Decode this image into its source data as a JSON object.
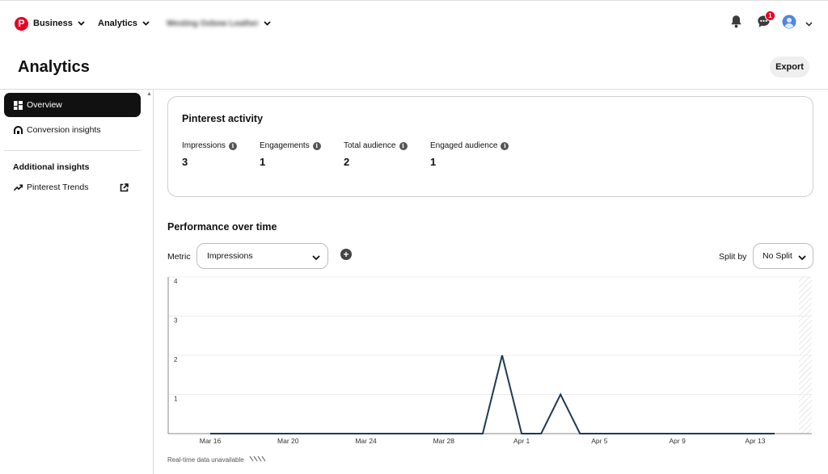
{
  "topnav": {
    "business_label": "Business",
    "analytics_label": "Analytics",
    "account_name": "Westing Oxbow Leather",
    "notification_count": "1"
  },
  "header": {
    "title": "Analytics",
    "export_label": "Export"
  },
  "sidebar": {
    "items": [
      {
        "label": "Overview",
        "active": true,
        "icon": "dashboard-icon"
      },
      {
        "label": "Conversion insights",
        "icon": "conversion-icon"
      }
    ],
    "additional_heading": "Additional insights",
    "extra_items": [
      {
        "label": "Pinterest Trends",
        "icon": "trend-icon"
      }
    ]
  },
  "activity": {
    "title": "Pinterest activity",
    "metrics": [
      {
        "label": "Impressions",
        "value": "3"
      },
      {
        "label": "Engagements",
        "value": "1"
      },
      {
        "label": "Total audience",
        "value": "2"
      },
      {
        "label": "Engaged audience",
        "value": "1"
      }
    ]
  },
  "performance": {
    "title": "Performance over time",
    "metric_label": "Metric",
    "metric_value": "Impressions",
    "split_label": "Split by",
    "split_value": "No Split",
    "realtime_note": "Real-time data unavailable"
  },
  "chart_data": {
    "type": "line",
    "title": "",
    "xlabel": "",
    "ylabel": "",
    "ylim": [
      0,
      4
    ],
    "yticks": [
      1,
      2,
      3,
      4
    ],
    "x_tick_labels": [
      "Mar 16",
      "Mar 20",
      "Mar 24",
      "Mar 28",
      "Apr 1",
      "Apr 5",
      "Apr 9",
      "Apr 13"
    ],
    "x": [
      "Mar 16",
      "Mar 17",
      "Mar 18",
      "Mar 19",
      "Mar 20",
      "Mar 21",
      "Mar 22",
      "Mar 23",
      "Mar 24",
      "Mar 25",
      "Mar 26",
      "Mar 27",
      "Mar 28",
      "Mar 29",
      "Mar 30",
      "Mar 31",
      "Apr 1",
      "Apr 2",
      "Apr 3",
      "Apr 4",
      "Apr 5",
      "Apr 6",
      "Apr 7",
      "Apr 8",
      "Apr 9",
      "Apr 10",
      "Apr 11",
      "Apr 12",
      "Apr 13",
      "Apr 14"
    ],
    "series": [
      {
        "values": [
          0,
          0,
          0,
          0,
          0,
          0,
          0,
          0,
          0,
          0,
          0,
          0,
          0,
          0,
          0,
          2,
          0,
          0,
          1,
          0,
          0,
          0,
          0,
          0,
          0,
          0,
          0,
          0,
          0,
          0
        ]
      }
    ],
    "line_color": "#1f3a52",
    "grid": true
  }
}
